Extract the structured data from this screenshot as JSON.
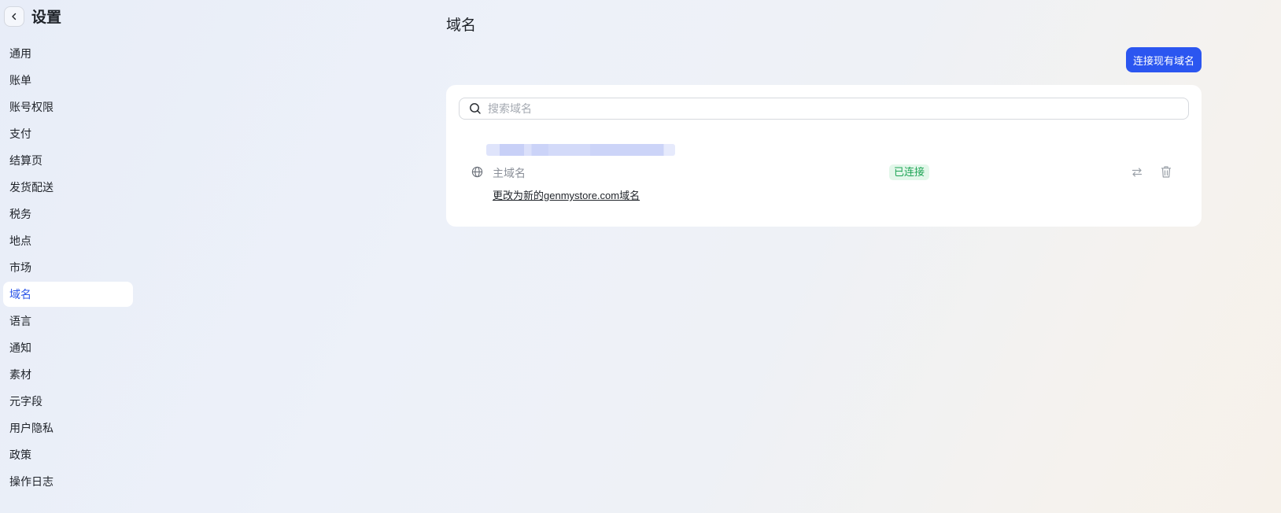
{
  "sidebar": {
    "title": "设置",
    "back_icon": "chevron-left-icon",
    "items": [
      {
        "label": "通用",
        "active": false
      },
      {
        "label": "账单",
        "active": false
      },
      {
        "label": "账号权限",
        "active": false
      },
      {
        "label": "支付",
        "active": false
      },
      {
        "label": "结算页",
        "active": false
      },
      {
        "label": "发货配送",
        "active": false
      },
      {
        "label": "税务",
        "active": false
      },
      {
        "label": "地点",
        "active": false
      },
      {
        "label": "市场",
        "active": false
      },
      {
        "label": "域名",
        "active": true
      },
      {
        "label": "语言",
        "active": false
      },
      {
        "label": "通知",
        "active": false
      },
      {
        "label": "素材",
        "active": false
      },
      {
        "label": "元字段",
        "active": false
      },
      {
        "label": "用户隐私",
        "active": false
      },
      {
        "label": "政策",
        "active": false
      },
      {
        "label": "操作日志",
        "active": false
      }
    ]
  },
  "main": {
    "title": "域名",
    "connect_button": "连接现有域名",
    "search": {
      "placeholder": "搜索域名",
      "value": ""
    },
    "domain": {
      "type_label": "主域名",
      "status": "已连接",
      "change_link": "更改为新的genmystore.com域名",
      "icons": [
        "globe-icon",
        "swap-icon",
        "trash-icon"
      ]
    }
  },
  "colors": {
    "accent": "#2b56f0",
    "active_nav_text": "#2b55e8",
    "status_bg": "#e3f7ea",
    "status_text": "#1ea455"
  }
}
